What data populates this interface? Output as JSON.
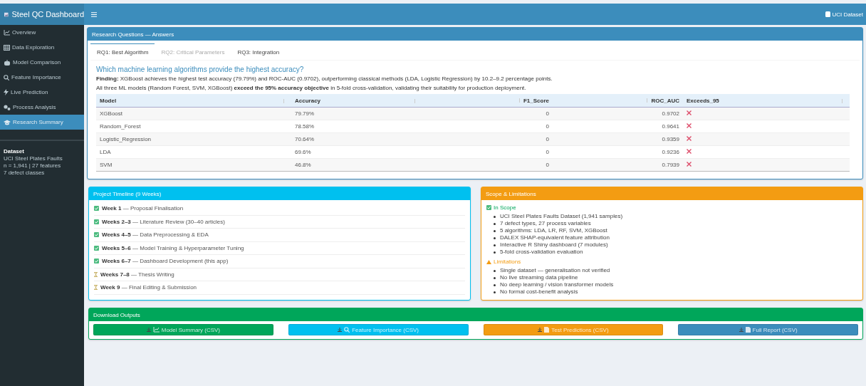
{
  "header": {
    "title": "Steel QC Dashboard",
    "badge": "UCI Dataset"
  },
  "sidebar": {
    "items": [
      {
        "label": "Overview",
        "selected": false
      },
      {
        "label": "Data Exploration",
        "selected": false
      },
      {
        "label": "Model Comparison",
        "selected": false
      },
      {
        "label": "Feature Importance",
        "selected": false
      },
      {
        "label": "Live Prediction",
        "selected": false
      },
      {
        "label": "Process Analysis",
        "selected": false
      },
      {
        "label": "Research Summary",
        "selected": true
      }
    ],
    "dataset": {
      "title": "Dataset",
      "lines": [
        "UCI Steel Plates Faults",
        "n = 1,941 | 27 features",
        "7 defect classes"
      ]
    }
  },
  "research": {
    "title": "Research Questions — Answers",
    "tabs": [
      {
        "label": "RQ1: Best Algorithm",
        "selected": true,
        "disabled": false
      },
      {
        "label": "RQ2: Critical Parameters",
        "selected": false,
        "disabled": true
      },
      {
        "label": "RQ3: Integration",
        "selected": false,
        "disabled": false
      }
    ],
    "question": "Which machine learning algorithms provide the highest accuracy?",
    "finding": "**Finding:** XGBoost achieves the highest test accuracy (79.79%) and ROC-AUC (0.9702), outperforming classical methods (LDA, Logistic Regression) by 10.2–9.2 percentage points.",
    "objective": "All three ML models (Random Forest, SVM, XGBoost) **exceed the 95% accuracy objective** in 5-fold cross-validation, validating their suitability for production deployment.",
    "table": {
      "columns": [
        "Model",
        "Accuracy",
        "F1_Score",
        "ROC_AUC",
        "Exceeds_95"
      ],
      "rows": [
        {
          "model": "XGBoost",
          "accuracy": "79.79%",
          "f1": "0",
          "roc": "0.9702",
          "exceeds": false
        },
        {
          "model": "Random_Forest",
          "accuracy": "78.58%",
          "f1": "0",
          "roc": "0.9641",
          "exceeds": false
        },
        {
          "model": "Logistic_Regression",
          "accuracy": "70.64%",
          "f1": "0",
          "roc": "0.9359",
          "exceeds": false
        },
        {
          "model": "LDA",
          "accuracy": "69.6%",
          "f1": "0",
          "roc": "0.9236",
          "exceeds": false
        },
        {
          "model": "SVM",
          "accuracy": "46.8%",
          "f1": "0",
          "roc": "0.7939",
          "exceeds": false
        }
      ]
    }
  },
  "timeline": {
    "title": "Project Timeline (9 Weeks)",
    "items": [
      {
        "text": "**Week 1** — Proposal Finalisation",
        "done": true
      },
      {
        "text": "**Weeks 2–3** — Literature Review (30–40 articles)",
        "done": true
      },
      {
        "text": "**Weeks 4–5** — Data Preprocessing & EDA",
        "done": true
      },
      {
        "text": "**Weeks 5–6** — Model Training & Hyperparameter Tuning",
        "done": true
      },
      {
        "text": "**Weeks 6–7** — Dashboard Development (this app)",
        "done": true
      },
      {
        "text": "**Weeks 7–8** — Thesis Writing",
        "done": false
      },
      {
        "text": "**Week 9** — Final Editing & Submission",
        "done": false
      }
    ]
  },
  "scope": {
    "title": "Scope & Limitations",
    "sections": [
      {
        "kind": "in_scope",
        "title": "In Scope",
        "items": [
          "UCI Steel Plates Faults Dataset (1,941 samples)",
          "7 defect types, 27 process variables",
          "5 algorithms: LDA, LR, RF, SVM, XGBoost",
          "DALEX SHAP-equivalent feature attribution",
          "Interactive R Shiny dashboard (7 modules)",
          "5-fold cross-validation evaluation"
        ]
      },
      {
        "kind": "limitations",
        "title": "Limitations",
        "items": [
          "Single dataset — generalisation not verified",
          "No live streaming data pipeline",
          "No deep learning / vision transformer models",
          "No formal cost-benefit analysis"
        ]
      }
    ]
  },
  "downloads": {
    "title": "Download Outputs",
    "buttons": [
      {
        "label": "Model Summary (CSV)",
        "color": "#00a65a"
      },
      {
        "label": "Feature Importance (CSV)",
        "color": "#00c0ef"
      },
      {
        "label": "Test Predictions (CSV)",
        "color": "#f39c12"
      },
      {
        "label": "Full Report (CSV)",
        "color": "#3c8dbc"
      }
    ]
  }
}
